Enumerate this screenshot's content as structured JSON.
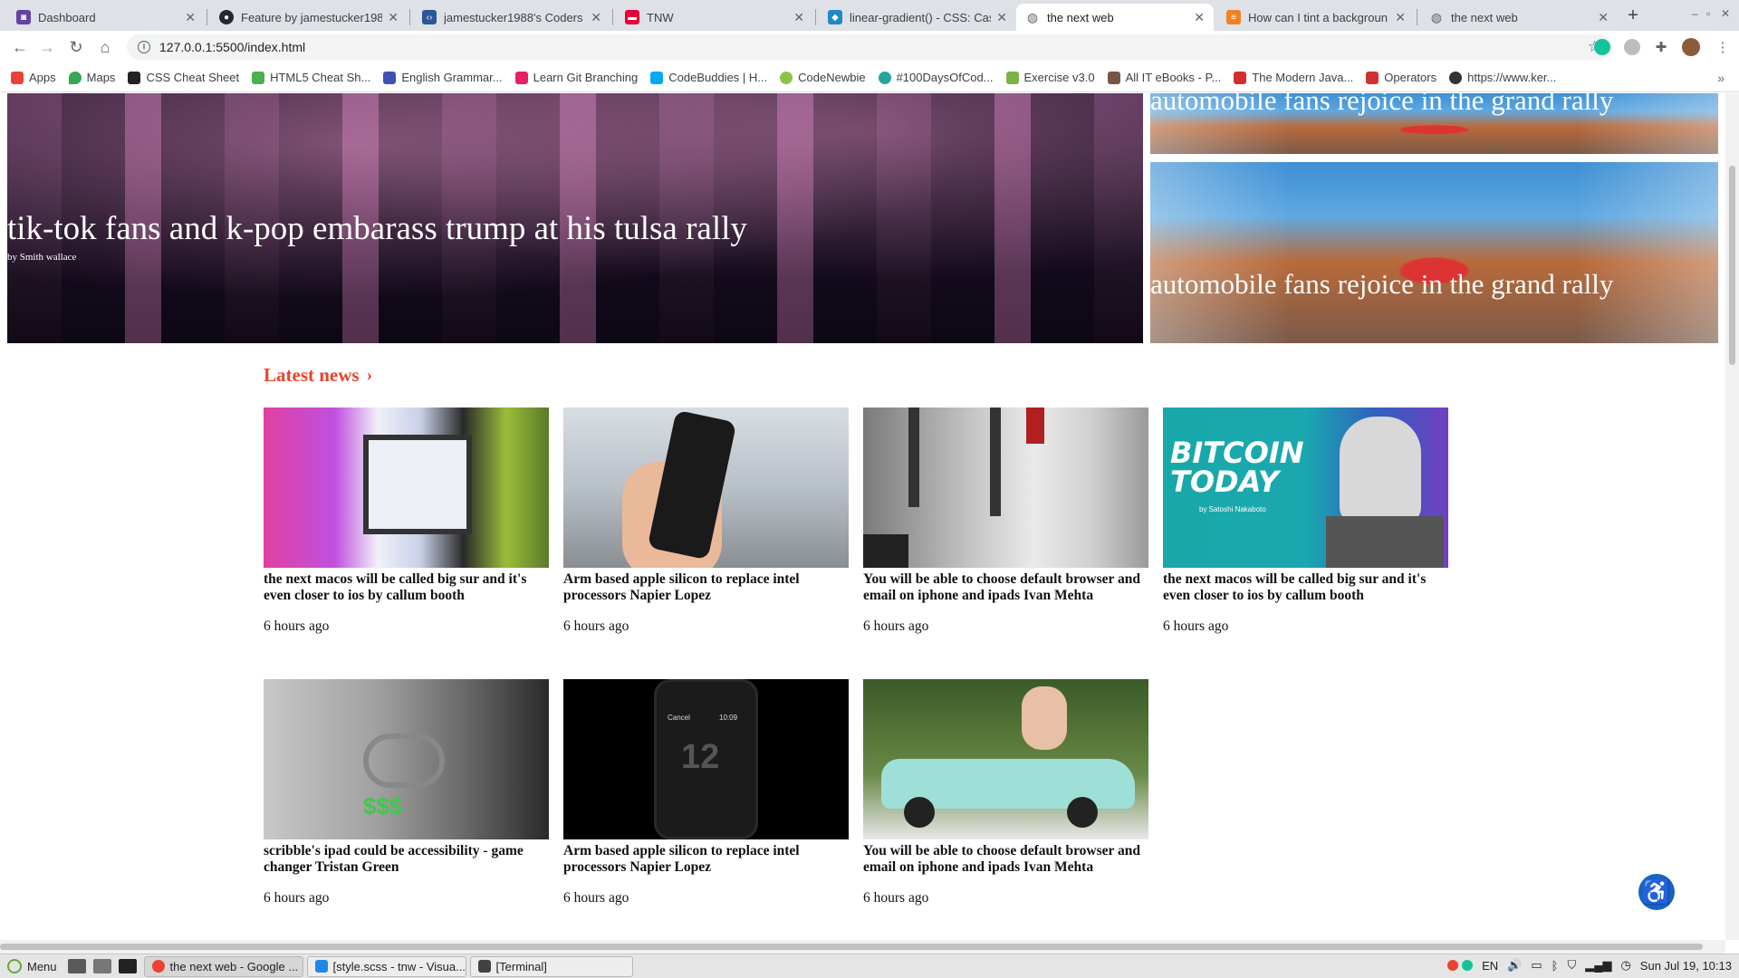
{
  "browser": {
    "tabs": [
      {
        "title": "Dashboard",
        "favicon": "twitch-like-icon",
        "color": "#6441a5"
      },
      {
        "title": "Feature by jamestucker1988",
        "favicon": "github-icon",
        "color": "#24292e"
      },
      {
        "title": "jamestucker1988's Coders",
        "favicon": "codersrank-icon",
        "color": "#2b5797"
      },
      {
        "title": "TNW",
        "favicon": "tnw-icon",
        "color": "#e4003a"
      },
      {
        "title": "linear-gradient() - CSS: Casc",
        "favicon": "mdn-icon",
        "color": "#1e88c8"
      },
      {
        "title": "the next web",
        "favicon": "globe-icon",
        "color": "#5f6368",
        "active": true
      },
      {
        "title": "How can I tint a backgroun",
        "favicon": "stackoverflow-icon",
        "color": "#f48024"
      },
      {
        "title": "the next web",
        "favicon": "globe-icon",
        "color": "#5f6368"
      }
    ],
    "new_tab": "+",
    "url": "127.0.0.1:5500/index.html",
    "bookmarks": [
      {
        "label": "Apps",
        "color": "#ea4335"
      },
      {
        "label": "Maps",
        "color": "#34a853"
      },
      {
        "label": "CSS Cheat Sheet",
        "color": "#222222"
      },
      {
        "label": "HTML5 Cheat Sh...",
        "color": "#4caf50"
      },
      {
        "label": "English Grammar...",
        "color": "#3f51b5"
      },
      {
        "label": "Learn Git Branching",
        "color": "#e91e63"
      },
      {
        "label": "CodeBuddies | H...",
        "color": "#03a9f4"
      },
      {
        "label": "CodeNewbie",
        "color": "#8bc34a"
      },
      {
        "label": "#100DaysOfCod...",
        "color": "#26a69a"
      },
      {
        "label": "Exercise v3.0",
        "color": "#7cb342"
      },
      {
        "label": "All IT eBooks - P...",
        "color": "#795548"
      },
      {
        "label": "The Modern Java...",
        "color": "#d32f2f"
      },
      {
        "label": "Operators",
        "color": "#d32f2f"
      },
      {
        "label": "https://www.ker...",
        "color": "#333333"
      }
    ]
  },
  "hero": {
    "main_title": "tik-tok fans and k-pop embarass trump at his tulsa rally",
    "main_author": "by Smith wallace",
    "side": [
      {
        "title": "automobile fans rejoice in the grand rally"
      },
      {
        "title": "automobile fans rejoice in the grand rally"
      }
    ]
  },
  "latest": {
    "heading": "Latest news",
    "chevron": "›",
    "articles": [
      {
        "title": "the next macos will be called big sur and it's even closer to ios by callum booth",
        "time": "6 hours ago"
      },
      {
        "title": "Arm based apple silicon to replace intel processors Napier Lopez",
        "time": "6 hours ago"
      },
      {
        "title": "You will be able to choose default browser and email on iphone and ipads Ivan Mehta",
        "time": "6 hours ago"
      },
      {
        "title": "the next macos will be called big sur and it's even closer to ios by callum booth",
        "time": "6 hours ago"
      },
      {
        "title": "scribble's ipad could be accessibility - game changer Tristan Green",
        "time": "6 hours ago"
      },
      {
        "title": "Arm based apple silicon to replace intel processors Napier Lopez",
        "time": "6 hours ago"
      },
      {
        "title": "You will be able to choose default browser and email on iphone and ipads Ivan Mehta",
        "time": "6 hours ago"
      }
    ],
    "bitcoin_art": {
      "headline": "BITCOIN TODAY",
      "byline": "by Satoshi Nakaboto"
    },
    "watch_art": {
      "left": "Cancel",
      "right": "10:09",
      "number": "12"
    }
  },
  "taskbar": {
    "menu_label": "Menu",
    "windows": [
      {
        "label": "the next web - Google ...",
        "color": "#ea4335"
      },
      {
        "label": "[style.scss - tnw - Visua...",
        "color": "#1e88e5"
      },
      {
        "label": "[Terminal]",
        "color": "#424242"
      }
    ],
    "language": "EN",
    "clock": "Sun Jul 19, 10:13"
  }
}
